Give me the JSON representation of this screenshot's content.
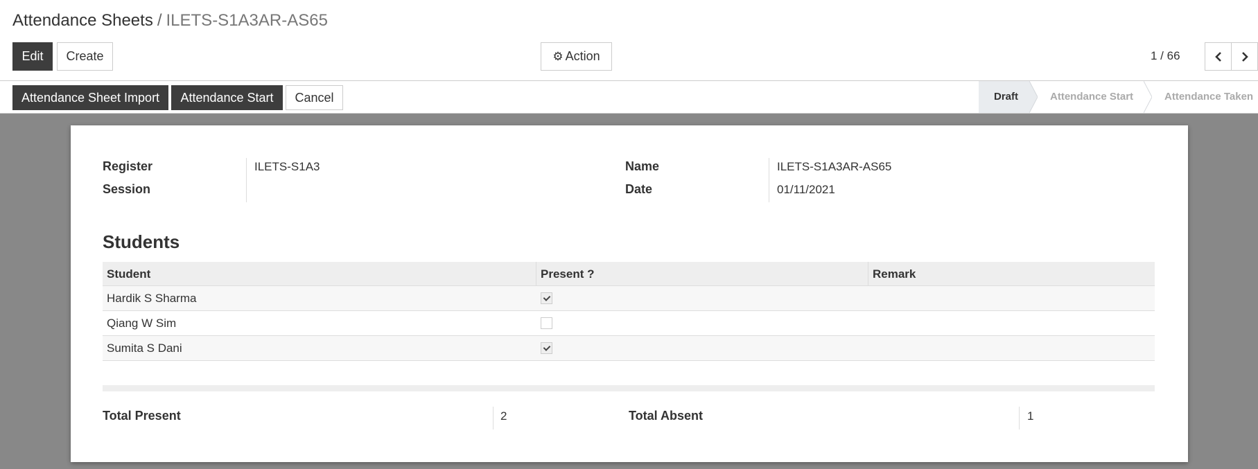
{
  "breadcrumb": {
    "parent": "Attendance Sheets",
    "separator": "/",
    "current": "ILETS-S1A3AR-AS65"
  },
  "toolbar": {
    "edit_label": "Edit",
    "create_label": "Create",
    "action_label": "Action"
  },
  "pager": {
    "value": "1 / 66"
  },
  "statusbar": {
    "import_label": "Attendance Sheet Import",
    "start_label": "Attendance Start",
    "cancel_label": "Cancel",
    "stages": [
      "Draft",
      "Attendance Start",
      "Attendance Taken"
    ],
    "active_stage": "Draft"
  },
  "form": {
    "register_label": "Register",
    "register_value": "ILETS-S1A3",
    "session_label": "Session",
    "session_value": "",
    "name_label": "Name",
    "name_value": "ILETS-S1A3AR-AS65",
    "date_label": "Date",
    "date_value": "01/11/2021"
  },
  "students": {
    "title": "Students",
    "columns": [
      "Student",
      "Present ?",
      "Remark"
    ],
    "rows": [
      {
        "student": "Hardik S Sharma",
        "present": true,
        "remark": ""
      },
      {
        "student": "Qiang W Sim",
        "present": false,
        "remark": ""
      },
      {
        "student": "Sumita S Dani",
        "present": true,
        "remark": ""
      }
    ]
  },
  "totals": {
    "present_label": "Total Present",
    "present_value": "2",
    "absent_label": "Total Absent",
    "absent_value": "1"
  },
  "colors": {
    "dark_button": "#3d3d3d",
    "form_background": "#888888",
    "active_stage_bg": "#e9ecef"
  }
}
